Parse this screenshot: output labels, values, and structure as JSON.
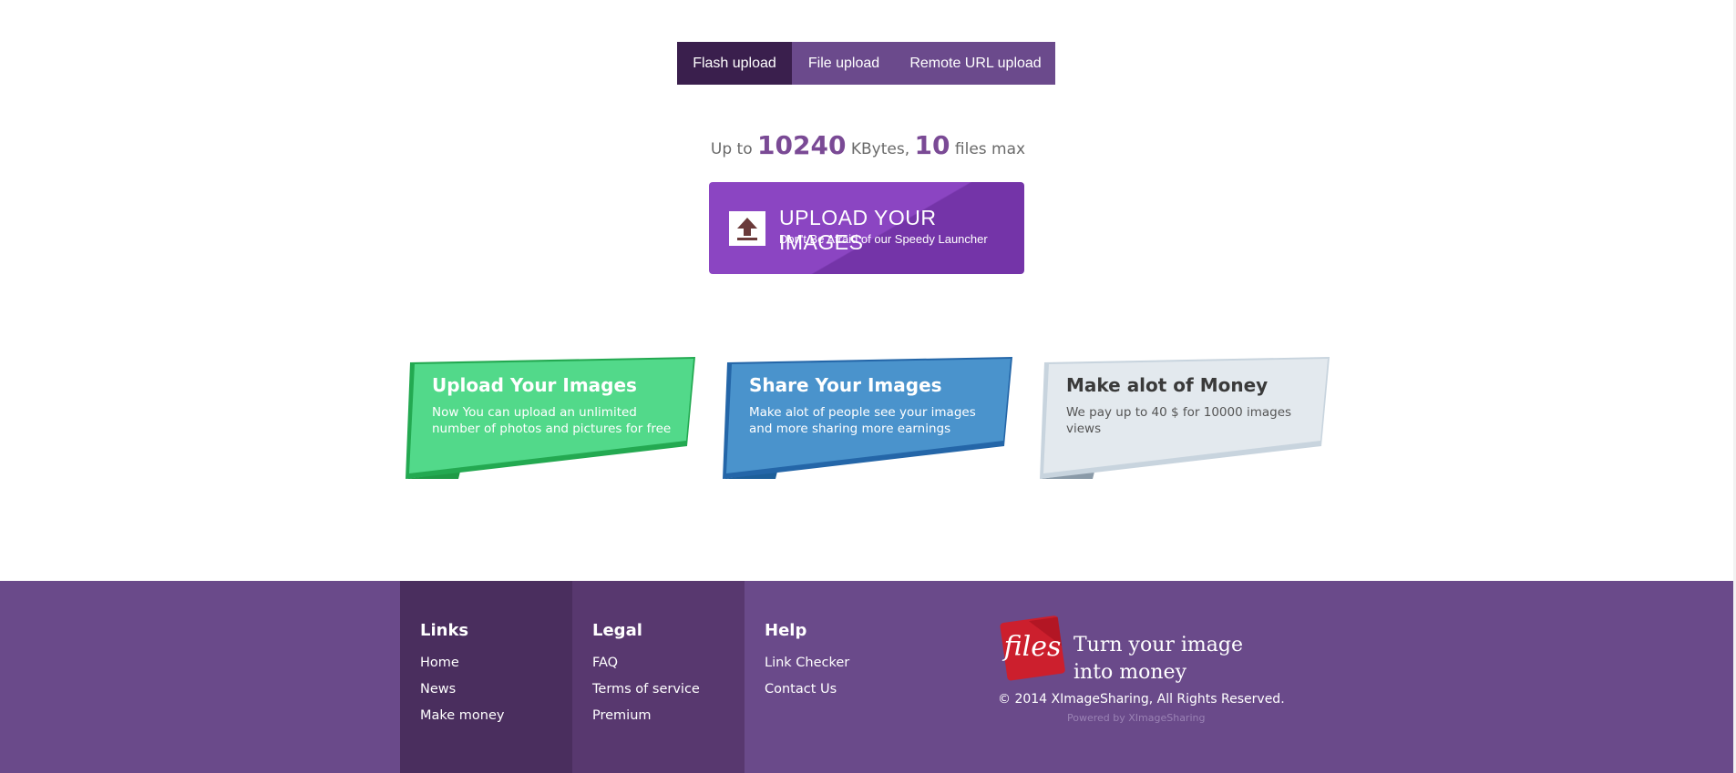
{
  "tabs": [
    {
      "label": "Flash upload",
      "active": true
    },
    {
      "label": "File upload",
      "active": false
    },
    {
      "label": "Remote URL upload",
      "active": false
    }
  ],
  "limits": {
    "prefix": "Up to",
    "max_kbytes": "10240",
    "kbytes_label": "KBytes,",
    "max_files": "10",
    "files_label": "files max"
  },
  "upload_button": {
    "title": "UPLOAD YOUR IMAGES",
    "subtitle": "Don't Be Afraid of our Speedy Launcher",
    "icon": "upload-icon"
  },
  "features": [
    {
      "title": "Upload Your Images",
      "text": "Now You can upload an unlimited number of photos and pictures for free",
      "color": "#3ecf6e"
    },
    {
      "title": "Share Your Images",
      "text": "Make alot of people see your images and more sharing more earnings",
      "color": "#3d86c4"
    },
    {
      "title": "Make alot of Money",
      "text": "We pay up to 40 $ for 10000 images views",
      "color": "#dbe3ea"
    }
  ],
  "footer": {
    "links": {
      "heading": "Links",
      "items": [
        "Home",
        "News",
        "Make money"
      ]
    },
    "legal": {
      "heading": "Legal",
      "items": [
        "FAQ",
        "Terms of service",
        "Premium"
      ]
    },
    "help": {
      "heading": "Help",
      "items": [
        "Link Checker",
        "Contact Us"
      ]
    },
    "logo_text": "files",
    "tagline_line1": "Turn your image",
    "tagline_line2": "into money",
    "copyright": "© 2014 XImageSharing, All Rights Reserved.",
    "powered": "Powered by XImageSharing"
  },
  "colors": {
    "tab_bar": "#6b4a8c",
    "tab_active": "#3a1f4d",
    "upload_button": "#8b45c2",
    "footer": "#6a4a8a",
    "logo_red": "#cc1f2d"
  }
}
